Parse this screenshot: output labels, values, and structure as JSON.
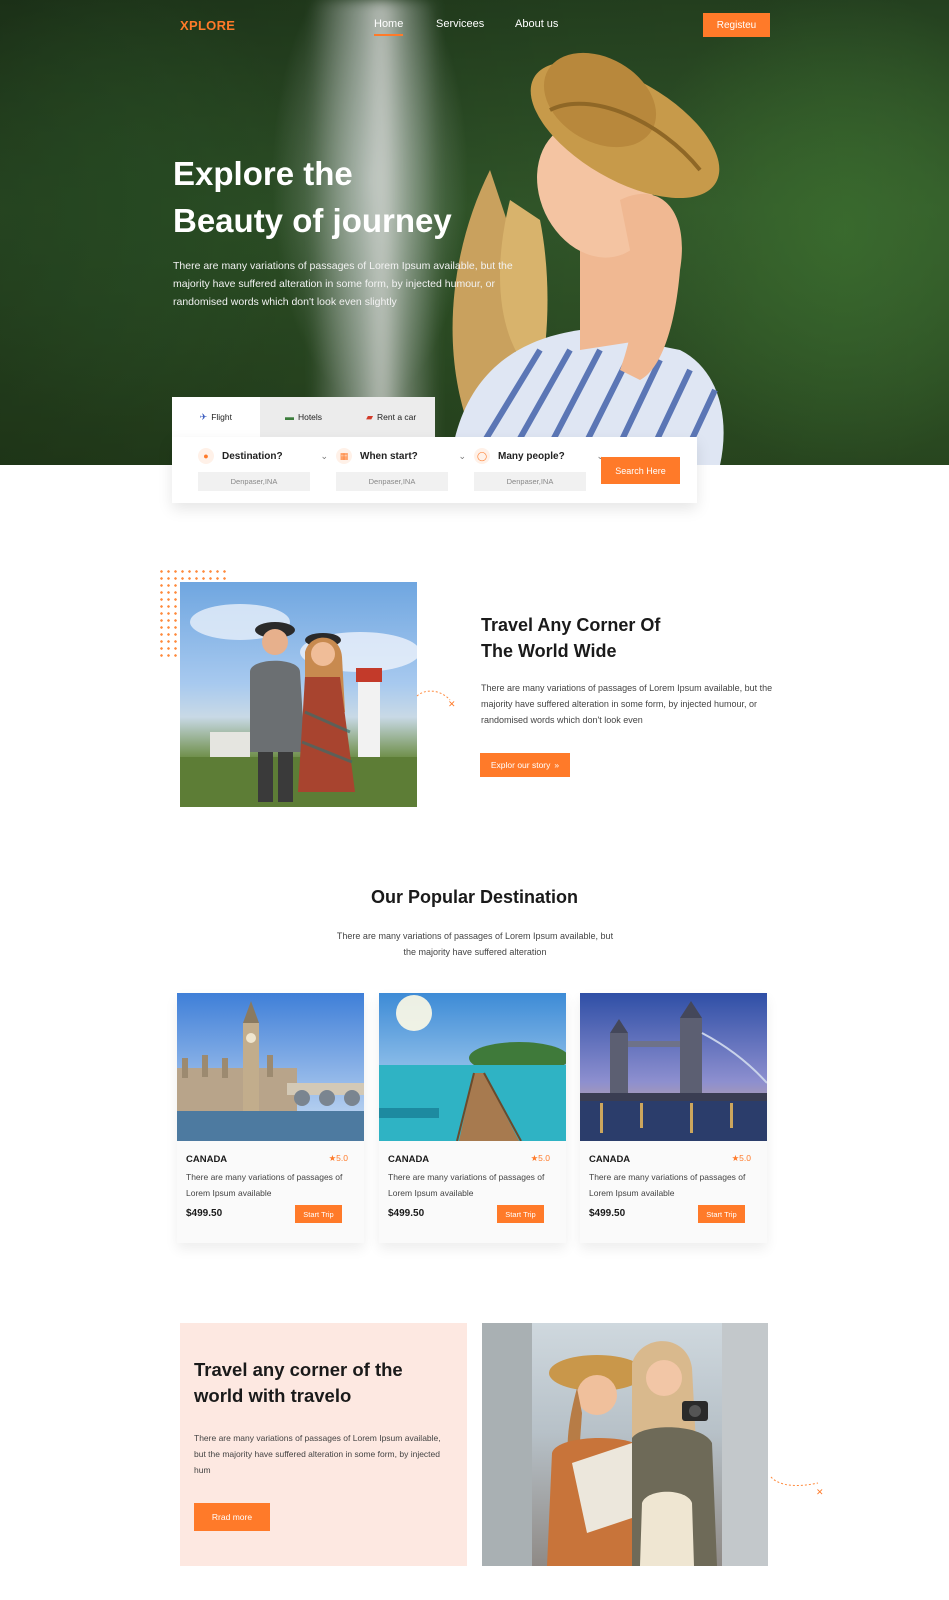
{
  "nav": {
    "logo": "XPLORE",
    "links": [
      "Home",
      "Servicees",
      "About us"
    ],
    "register": "Registeu"
  },
  "hero": {
    "title_line1": "Explore the",
    "title_line2": "Beauty of journey",
    "description": "There are many variations of passages of Lorem Ipsum available, but the majority have suffered alteration in some form, by injected humour, or randomised words which don't look even slightly"
  },
  "search": {
    "tabs": [
      {
        "label": "Flight",
        "icon": "plane-icon"
      },
      {
        "label": "Hotels",
        "icon": "bed-icon"
      },
      {
        "label": "Rent a car",
        "icon": "car-icon"
      }
    ],
    "fields": [
      {
        "label": "Destination?",
        "value": "Denpaser,INA",
        "icon": "location-pin-icon"
      },
      {
        "label": "When start?",
        "value": "Denpaser,INA",
        "icon": "calendar-icon"
      },
      {
        "label": "Many people?",
        "value": "Denpaser,INA",
        "icon": "user-icon"
      }
    ],
    "button": "Search Here"
  },
  "about": {
    "title_line1": "Travel Any Corner Of",
    "title_line2": "The World Wide",
    "description": "There are many variations of passages of Lorem Ipsum available, but the majority have suffered alteration in some form, by injected humour, or randomised words which don't look even",
    "button": "Explor our story",
    "button_icon": "double-chevron-right-icon"
  },
  "popular": {
    "title": "Our Popular Destination",
    "subtitle": "There are many variations of passages of Lorem Ipsum available, but the majority have suffered alteration",
    "cards": [
      {
        "name": "CANADA",
        "rating": "★5.0",
        "description": "There are many variations of passages of Lorem Ipsum available",
        "price": "$499.50",
        "button": "Start Trip",
        "image": "big-ben-photo"
      },
      {
        "name": "CANADA",
        "rating": "★5.0",
        "description": "There are many variations of passages of Lorem Ipsum available",
        "price": "$499.50",
        "button": "Start Trip",
        "image": "pier-sea-photo"
      },
      {
        "name": "CANADA",
        "rating": "★5.0",
        "description": "There are many variations of passages of Lorem Ipsum available",
        "price": "$499.50",
        "button": "Start Trip",
        "image": "tower-bridge-photo"
      }
    ]
  },
  "promo": {
    "title_line1": "Travel any corner of the",
    "title_line2": "world with travelo",
    "description": "There are many variations of passages of Lorem Ipsum available, but the majority have suffered alteration in some form, by injected hum",
    "button": "Rrad more"
  },
  "colors": {
    "accent": "#ff7a29",
    "promo_bg": "#fde8e1",
    "text_dark": "#1a1a1a"
  }
}
